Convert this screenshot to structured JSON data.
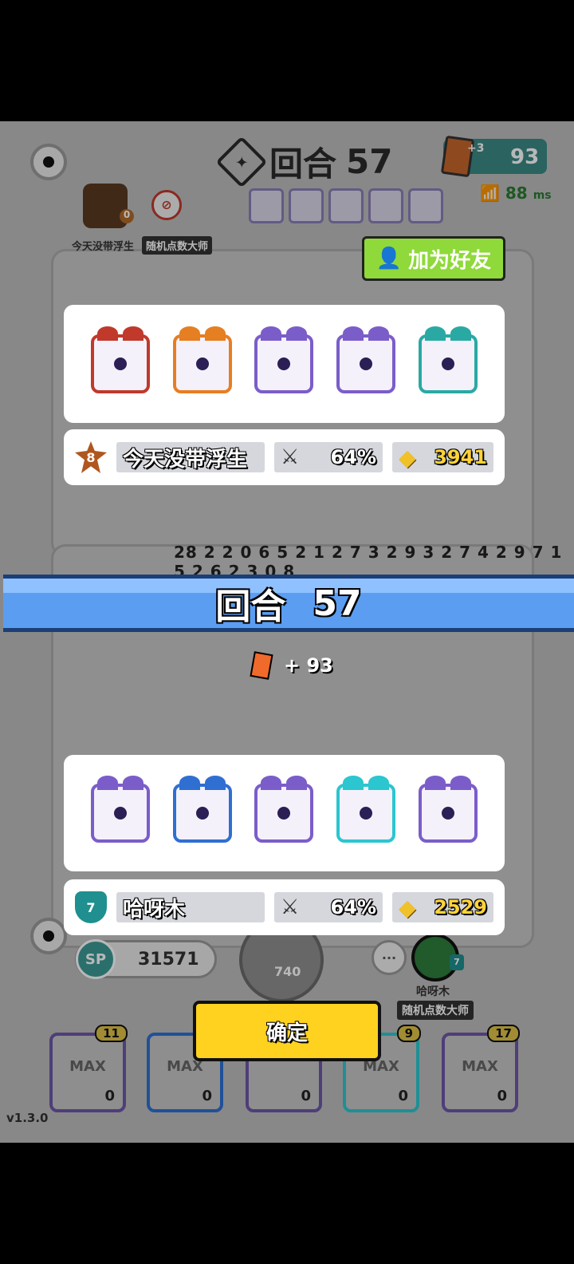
{
  "game": {
    "round_label": "回合",
    "round_number": "57",
    "card_bonus": "+3",
    "card_count": "93",
    "ping": "88",
    "ping_unit": "ms",
    "add_friend_label": "加为好友",
    "self_name_tag": "今天没带浮生",
    "self_title_tag": "随机点数大师",
    "self_avatar_badge": "0",
    "board_numbers": "28 2 2 0 6 5 2 1 2 7 3 2 9   3 2 7 4 2 9 7 1 5 2 6 2 3 0 8",
    "card_gain": "+ 93",
    "confirm_label": "确定",
    "version": "v1.3.0",
    "sp_label": "SP",
    "sp_value": "31571",
    "spin_cost": "740",
    "chat_label": "···",
    "opp_name_tag": "哈呀木",
    "opp_title_tag": "随机点数大师",
    "opp_avatar_badge": "7",
    "slots": [
      {
        "level": "11",
        "max": "MAX",
        "count": "0"
      },
      {
        "level": "",
        "max": "MAX",
        "count": "0"
      },
      {
        "level": "",
        "max": "",
        "count": "0"
      },
      {
        "level": "9",
        "max": "MAX",
        "count": "0"
      },
      {
        "level": "17",
        "max": "MAX",
        "count": "0"
      }
    ]
  },
  "player1": {
    "rank": "8",
    "name": "今天没带浮生",
    "win_rate": "64%",
    "sp": "3941",
    "dice": [
      {
        "name": "blade-die",
        "color": "#c0392b"
      },
      {
        "name": "infinity-die",
        "color": "#e67e22"
      },
      {
        "name": "summoner-die",
        "color": "#7b5dc9"
      },
      {
        "name": "crack-die",
        "color": "#7b5dc9"
      },
      {
        "name": "blessing-die",
        "color": "#2aa9a4"
      }
    ]
  },
  "player2": {
    "rank": "7",
    "name": "哈呀木",
    "win_rate": "64%",
    "sp": "2529",
    "dice": [
      {
        "name": "crack-die",
        "color": "#7b5dc9"
      },
      {
        "name": "ice-die",
        "color": "#2f6fd1"
      },
      {
        "name": "summoner-die",
        "color": "#7b5dc9"
      },
      {
        "name": "wind-die",
        "color": "#2bc6cf"
      },
      {
        "name": "shield-die",
        "color": "#7b5dc9"
      }
    ]
  }
}
